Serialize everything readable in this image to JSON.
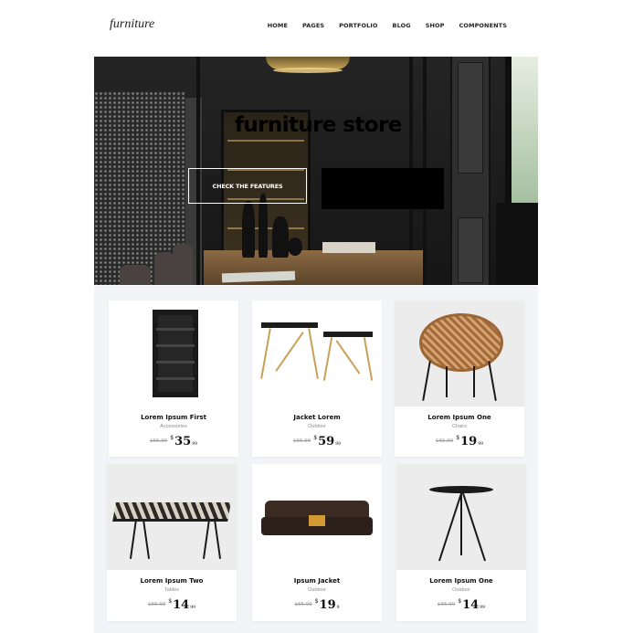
{
  "header": {
    "logo": "furniture",
    "nav": [
      "HOME",
      "PAGES",
      "PORTFOLIO",
      "BLOG",
      "SHOP",
      "COMPONENTS"
    ]
  },
  "hero": {
    "title": "furniture store",
    "button": "CHECK THE FEATURES"
  },
  "products": [
    {
      "name": "Lorem Ipsum First",
      "category": "Accessories",
      "old_price": "$65.99",
      "currency": "$",
      "price": "35",
      "cents": "99"
    },
    {
      "name": "Jacket Lorem",
      "category": "Outdoor",
      "old_price": "$65.99",
      "currency": "$",
      "price": "59",
      "cents": "99"
    },
    {
      "name": "Lorem Ipsum One",
      "category": "Chairs",
      "old_price": "$65.99",
      "currency": "$",
      "price": "19",
      "cents": "99"
    },
    {
      "name": "Lorem Ipsum Two",
      "category": "Tables",
      "old_price": "$65.99",
      "currency": "$",
      "price": "14",
      "cents": "99"
    },
    {
      "name": "Ipsum Jacket",
      "category": "Outdoor",
      "old_price": "$65.99",
      "currency": "$",
      "price": "19",
      "cents": "9"
    },
    {
      "name": "Lorem Ipsum One",
      "category": "Outdoor",
      "old_price": "$65.99",
      "currency": "$",
      "price": "14",
      "cents": "99"
    }
  ],
  "colors": {
    "accent": "#000000",
    "section_bg": "#f2f4f8"
  }
}
